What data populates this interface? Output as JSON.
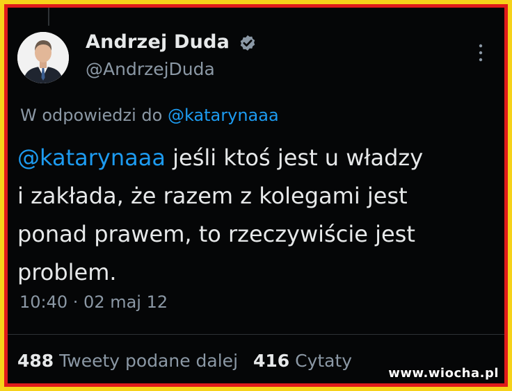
{
  "author": {
    "display_name": "Andrzej Duda",
    "handle": "@AndrzejDuda",
    "verified_icon": "verified-badge-icon",
    "avatar": "portrait-avatar"
  },
  "reply": {
    "prefix": "W odpowiedzi do",
    "mention": "@katarynaaa"
  },
  "tweet": {
    "mention": "@katarynaaa",
    "line1_rest": " jeśli ktoś jest u władzy",
    "line2": "i zakłada, że razem z kolegami jest",
    "line3": "ponad prawem, to rzeczywiście jest",
    "line4": "problem."
  },
  "timestamp": "10:40 · 02 maj 12",
  "stats": {
    "retweets_count": "488",
    "retweets_label": "Tweety podane dalej",
    "quotes_count": "416",
    "quotes_label": "Cytaty"
  },
  "watermark": "www.wiocha.pl",
  "colors": {
    "background": "#050607",
    "link": "#1d9bf0",
    "text": "#e7e9ea",
    "muted": "#8b98a5",
    "frame_yellow": "#f6d21a",
    "frame_red": "#e01b1b"
  }
}
